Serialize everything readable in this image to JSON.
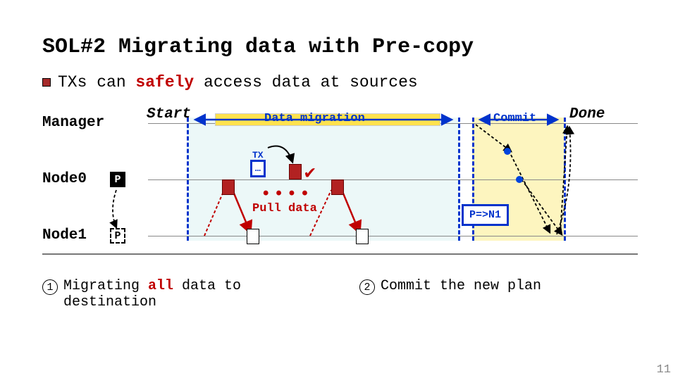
{
  "title": "SOL#2 Migrating data with Pre-copy",
  "bullet": {
    "pre": "TXs can ",
    "em": "safely",
    "post": " access data at sources"
  },
  "rows": {
    "manager": "Manager",
    "node0": "Node0",
    "node1": "Node1"
  },
  "p_label": "P",
  "start": "Start",
  "done": "Done",
  "phase_migration": "Data migration",
  "phase_commit": "Commit",
  "tx_label": "TX",
  "tx_dots": "…",
  "pull": "Pull data",
  "commit_box": "P=>N1",
  "footer": {
    "one": {
      "pre": "Migrating ",
      "em": "all",
      "post": " data to destination"
    },
    "two": "Commit the new plan"
  },
  "page": "11"
}
